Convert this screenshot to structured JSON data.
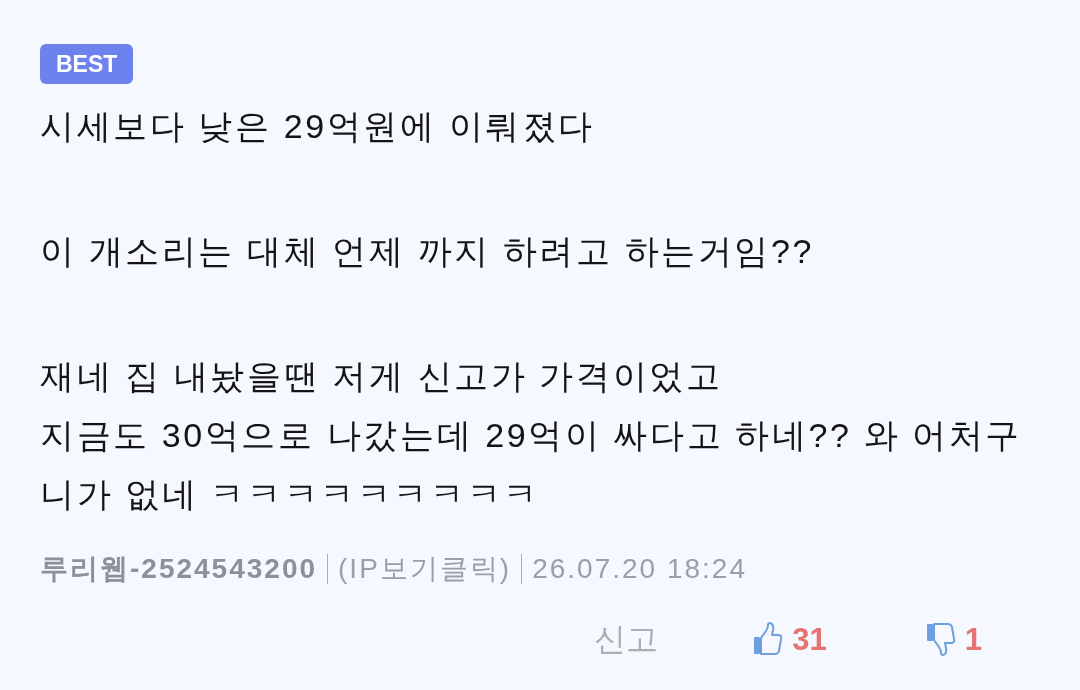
{
  "badge": "BEST",
  "comment": {
    "paragraphs": [
      [
        "시세보다 낮은 29억원에 이뤄졌다"
      ],
      [
        "이 개소리는 대체 언제 까지 하려고 하는거임??"
      ],
      [
        "재네 집 내놨을땐 저게 신고가 가격이었고",
        "지금도 30억으로 나갔는데 29억이 싸다고 하네?? 와 어처구",
        "니가 없네 ㅋㅋㅋㅋㅋㅋㅋㅋㅋ"
      ]
    ]
  },
  "meta": {
    "author": "루리웹-2524543200",
    "ip_link": "(IP보기클릭)",
    "date": "26.07.20 18:24"
  },
  "actions": {
    "report": "신고",
    "upvotes": "31",
    "downvotes": "1"
  }
}
